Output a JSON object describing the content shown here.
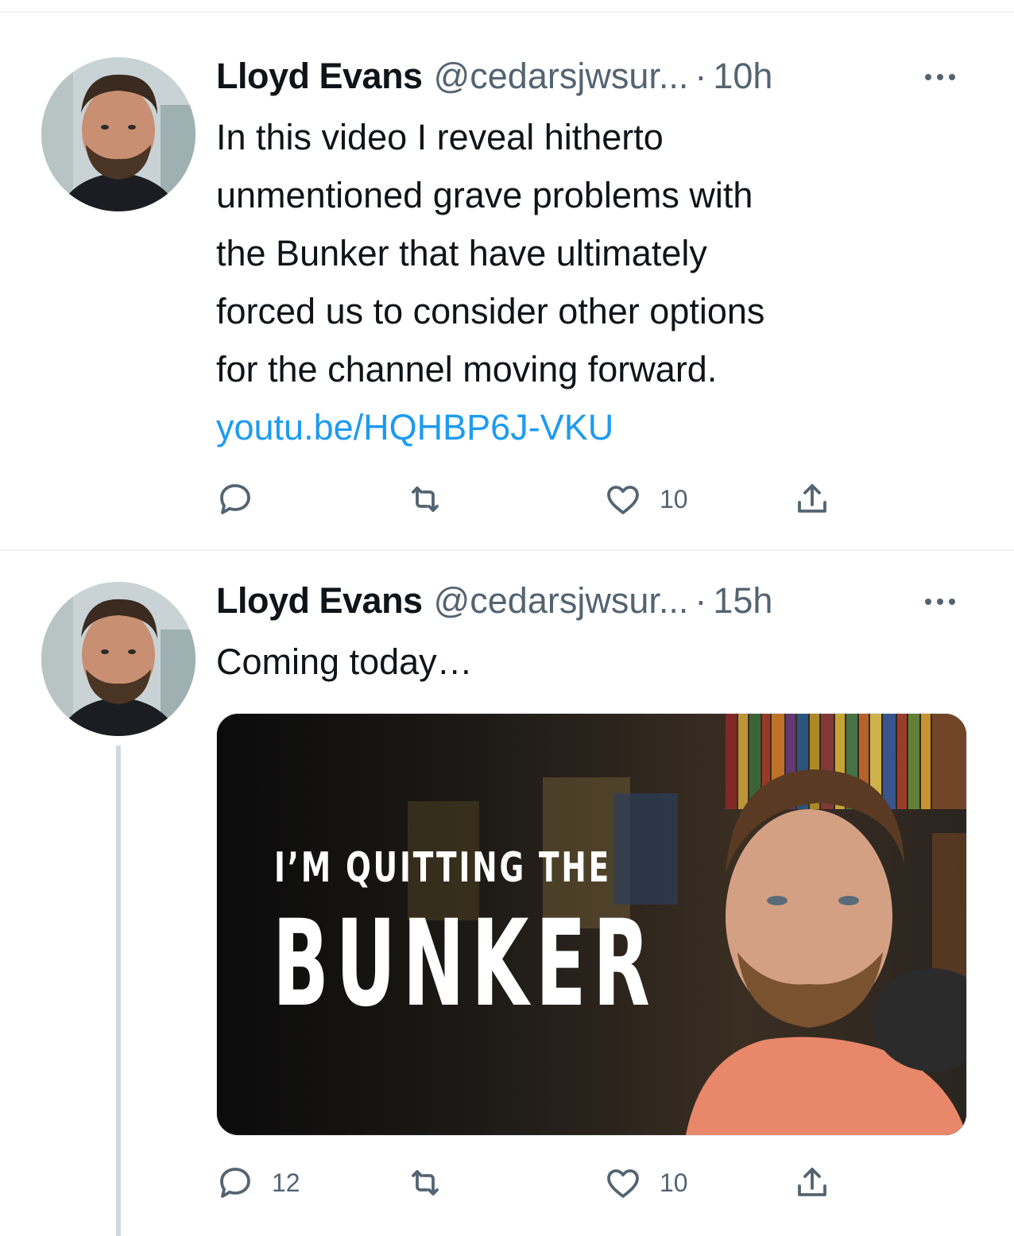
{
  "tweets": [
    {
      "author_name": "Lloyd Evans",
      "handle": "@cedarsjwsur...",
      "separator": "·",
      "time": "10h",
      "text_lines": [
        "In this video I reveal hitherto",
        "unmentioned grave problems with",
        "the Bunker that have ultimately",
        "forced us to consider other options",
        "for the channel moving forward."
      ],
      "link": "youtu.be/HQHBP6J-VKU",
      "reply_count": "",
      "retweet_count": "",
      "like_count": "10"
    },
    {
      "author_name": "Lloyd Evans",
      "handle": "@cedarsjwsur...",
      "separator": "·",
      "time": "15h",
      "text_lines": [
        "Coming today…"
      ],
      "media": {
        "caption_line1": "I’M QUITTING THE",
        "caption_line2": "BUNKER"
      },
      "reply_count": "12",
      "retweet_count": "",
      "like_count": "10"
    }
  ],
  "icons": {
    "reply": "reply-icon",
    "retweet": "retweet-icon",
    "like": "like-icon",
    "share": "share-icon",
    "more": "more-icon"
  },
  "colors": {
    "link": "#1d9bf0",
    "secondary_text": "#536471",
    "divider": "#eff3f4",
    "thread_line": "#cfd9de"
  }
}
